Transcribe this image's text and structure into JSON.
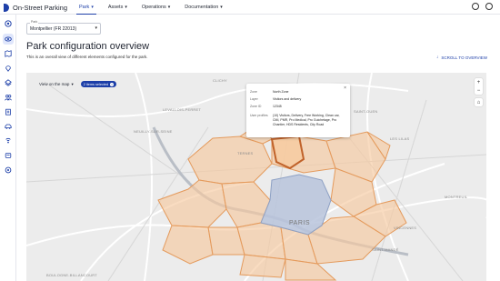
{
  "header": {
    "app_name": "On-Street Parking",
    "nav": [
      {
        "label": "Park",
        "active": true
      },
      {
        "label": "Assets",
        "active": false
      },
      {
        "label": "Operations",
        "active": false
      },
      {
        "label": "Documentation",
        "active": false
      }
    ]
  },
  "park_select": {
    "label": "Park",
    "value": "Montpellier (FR 22013)"
  },
  "page": {
    "title": "Park configuration overview",
    "subtitle": "This is an overall view of different elements configured for the park.",
    "scroll_link": "SCROLL TO OVERVIEW"
  },
  "map": {
    "view_label": "View on the map",
    "chip_label": "2 items selected",
    "labels": {
      "clichy": "CLICHY",
      "levallois": "LEVALLOIS-PERRET",
      "neuilly": "NEUILLY-SUR-SEINE",
      "ternes": "TERNES",
      "paris": "PARIS",
      "montreuil": "MONTREUIL",
      "boulogne": "BOULOGNE-BILLANCOURT",
      "lilas": "LES LILAS",
      "vincennes": "VINCENNES",
      "saint_mande": "SAINT-MANDÉ",
      "saint_ouen": "SAINT-OUEN"
    },
    "colors": {
      "zone_fill": "#f6caa0",
      "zone_stroke": "#e49a5c",
      "selected_stroke": "#c0622a",
      "center_fill": "#b8c4dc"
    }
  },
  "popup": {
    "zone_key": "Zone",
    "zone_value": "North Zone",
    "layer_key": "Layer",
    "layer_value": "Visitors and delivery",
    "id_key": "Zone ID",
    "id_value": "12345",
    "profiles_key": "User profiles",
    "profiles_value": "(10) Visitors, Delivery, Free Working, Clean car, CMI, PMR, Pro Medical, Pro Guichetage, Pro Chantier, HDS Residents, City Road"
  }
}
